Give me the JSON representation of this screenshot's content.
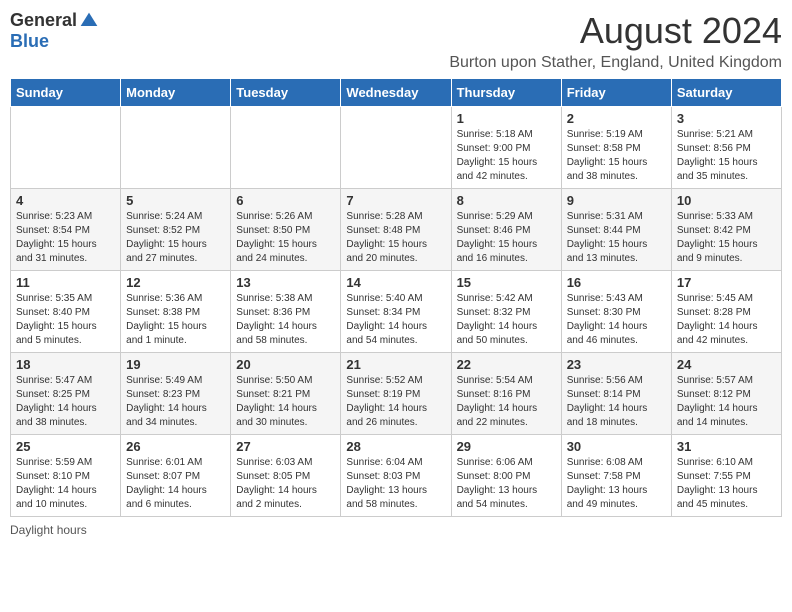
{
  "header": {
    "logo_general": "General",
    "logo_blue": "Blue",
    "month_title": "August 2024",
    "subtitle": "Burton upon Stather, England, United Kingdom"
  },
  "days_of_week": [
    "Sunday",
    "Monday",
    "Tuesday",
    "Wednesday",
    "Thursday",
    "Friday",
    "Saturday"
  ],
  "weeks": [
    [
      {
        "day": "",
        "info": ""
      },
      {
        "day": "",
        "info": ""
      },
      {
        "day": "",
        "info": ""
      },
      {
        "day": "",
        "info": ""
      },
      {
        "day": "1",
        "info": "Sunrise: 5:18 AM\nSunset: 9:00 PM\nDaylight: 15 hours\nand 42 minutes."
      },
      {
        "day": "2",
        "info": "Sunrise: 5:19 AM\nSunset: 8:58 PM\nDaylight: 15 hours\nand 38 minutes."
      },
      {
        "day": "3",
        "info": "Sunrise: 5:21 AM\nSunset: 8:56 PM\nDaylight: 15 hours\nand 35 minutes."
      }
    ],
    [
      {
        "day": "4",
        "info": "Sunrise: 5:23 AM\nSunset: 8:54 PM\nDaylight: 15 hours\nand 31 minutes."
      },
      {
        "day": "5",
        "info": "Sunrise: 5:24 AM\nSunset: 8:52 PM\nDaylight: 15 hours\nand 27 minutes."
      },
      {
        "day": "6",
        "info": "Sunrise: 5:26 AM\nSunset: 8:50 PM\nDaylight: 15 hours\nand 24 minutes."
      },
      {
        "day": "7",
        "info": "Sunrise: 5:28 AM\nSunset: 8:48 PM\nDaylight: 15 hours\nand 20 minutes."
      },
      {
        "day": "8",
        "info": "Sunrise: 5:29 AM\nSunset: 8:46 PM\nDaylight: 15 hours\nand 16 minutes."
      },
      {
        "day": "9",
        "info": "Sunrise: 5:31 AM\nSunset: 8:44 PM\nDaylight: 15 hours\nand 13 minutes."
      },
      {
        "day": "10",
        "info": "Sunrise: 5:33 AM\nSunset: 8:42 PM\nDaylight: 15 hours\nand 9 minutes."
      }
    ],
    [
      {
        "day": "11",
        "info": "Sunrise: 5:35 AM\nSunset: 8:40 PM\nDaylight: 15 hours\nand 5 minutes."
      },
      {
        "day": "12",
        "info": "Sunrise: 5:36 AM\nSunset: 8:38 PM\nDaylight: 15 hours\nand 1 minute."
      },
      {
        "day": "13",
        "info": "Sunrise: 5:38 AM\nSunset: 8:36 PM\nDaylight: 14 hours\nand 58 minutes."
      },
      {
        "day": "14",
        "info": "Sunrise: 5:40 AM\nSunset: 8:34 PM\nDaylight: 14 hours\nand 54 minutes."
      },
      {
        "day": "15",
        "info": "Sunrise: 5:42 AM\nSunset: 8:32 PM\nDaylight: 14 hours\nand 50 minutes."
      },
      {
        "day": "16",
        "info": "Sunrise: 5:43 AM\nSunset: 8:30 PM\nDaylight: 14 hours\nand 46 minutes."
      },
      {
        "day": "17",
        "info": "Sunrise: 5:45 AM\nSunset: 8:28 PM\nDaylight: 14 hours\nand 42 minutes."
      }
    ],
    [
      {
        "day": "18",
        "info": "Sunrise: 5:47 AM\nSunset: 8:25 PM\nDaylight: 14 hours\nand 38 minutes."
      },
      {
        "day": "19",
        "info": "Sunrise: 5:49 AM\nSunset: 8:23 PM\nDaylight: 14 hours\nand 34 minutes."
      },
      {
        "day": "20",
        "info": "Sunrise: 5:50 AM\nSunset: 8:21 PM\nDaylight: 14 hours\nand 30 minutes."
      },
      {
        "day": "21",
        "info": "Sunrise: 5:52 AM\nSunset: 8:19 PM\nDaylight: 14 hours\nand 26 minutes."
      },
      {
        "day": "22",
        "info": "Sunrise: 5:54 AM\nSunset: 8:16 PM\nDaylight: 14 hours\nand 22 minutes."
      },
      {
        "day": "23",
        "info": "Sunrise: 5:56 AM\nSunset: 8:14 PM\nDaylight: 14 hours\nand 18 minutes."
      },
      {
        "day": "24",
        "info": "Sunrise: 5:57 AM\nSunset: 8:12 PM\nDaylight: 14 hours\nand 14 minutes."
      }
    ],
    [
      {
        "day": "25",
        "info": "Sunrise: 5:59 AM\nSunset: 8:10 PM\nDaylight: 14 hours\nand 10 minutes."
      },
      {
        "day": "26",
        "info": "Sunrise: 6:01 AM\nSunset: 8:07 PM\nDaylight: 14 hours\nand 6 minutes."
      },
      {
        "day": "27",
        "info": "Sunrise: 6:03 AM\nSunset: 8:05 PM\nDaylight: 14 hours\nand 2 minutes."
      },
      {
        "day": "28",
        "info": "Sunrise: 6:04 AM\nSunset: 8:03 PM\nDaylight: 13 hours\nand 58 minutes."
      },
      {
        "day": "29",
        "info": "Sunrise: 6:06 AM\nSunset: 8:00 PM\nDaylight: 13 hours\nand 54 minutes."
      },
      {
        "day": "30",
        "info": "Sunrise: 6:08 AM\nSunset: 7:58 PM\nDaylight: 13 hours\nand 49 minutes."
      },
      {
        "day": "31",
        "info": "Sunrise: 6:10 AM\nSunset: 7:55 PM\nDaylight: 13 hours\nand 45 minutes."
      }
    ]
  ],
  "footer": {
    "daylight_label": "Daylight hours"
  },
  "colors": {
    "header_bg": "#2a6db5",
    "accent_blue": "#2a6db5"
  }
}
